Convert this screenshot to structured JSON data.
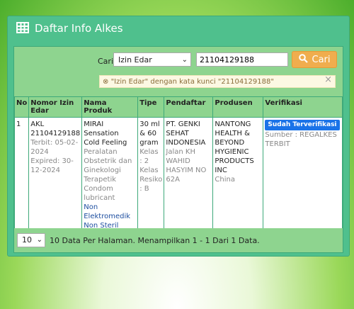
{
  "panel": {
    "title": "Daftar Info Alkes",
    "icon": "table-grid-icon"
  },
  "search": {
    "label": "Cari",
    "field_selected": "Izin Edar",
    "query": "21104129188",
    "button_label": "Cari",
    "filter_note": "\"Izin Edar\" dengan kata kunci \"21104129188\""
  },
  "table": {
    "headers": [
      "No",
      "Nomor Izin Edar",
      "Nama Produk",
      "Tipe",
      "Pendaftar",
      "Produsen",
      "Verifikasi"
    ],
    "rows": [
      {
        "no": "1",
        "izin": "AKL 21104129188",
        "terbit": "Terbit: 05-02-2024",
        "expired": "Expired: 30-12-2024",
        "produk": "MIRAI Sensation Cold Feeling",
        "kategori": "Peralatan Obstetrik dan Ginekologi Terapetik Condom lubricant",
        "elektromedik": "Non Elektromedik Non Steril",
        "tipe": "30 ml & 60 gram",
        "kelas": "Kelas : 2",
        "risiko": "Kelas Resiko : B",
        "pendaftar": "PT. GENKI SEHAT INDONESIA",
        "alamat": "Jalan KH WAHID HASYIM NO 62A",
        "produsen": "NANTONG HEALTH & BEYOND HYGIENIC PRODUCTS INC",
        "negara": "China",
        "badge": "Sudah Terverifikasi",
        "sumber": "Sumber : REGALKES TERBIT"
      }
    ]
  },
  "footer": {
    "per_page": "10",
    "summary": "10 Data Per Halaman. Menampilkan 1 - 1 Dari 1 Data."
  },
  "colors": {
    "panel": "#4fc08d",
    "header_green": "#8ed48f",
    "button": "#f0ad4e",
    "badge": "#1a73e8"
  }
}
